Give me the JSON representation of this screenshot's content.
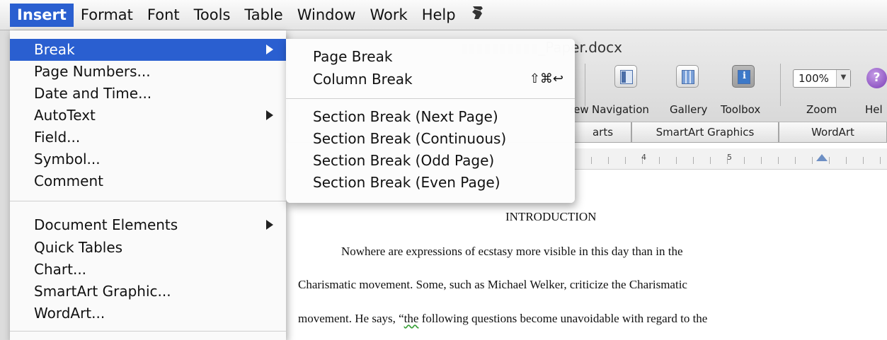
{
  "menubar": {
    "items": [
      "Insert",
      "Format",
      "Font",
      "Tools",
      "Table",
      "Window",
      "Work",
      "Help"
    ],
    "active": "Insert",
    "trailing_icon": "script-menu-icon"
  },
  "window": {
    "title_partial": "_Paper.docx"
  },
  "toolbar": {
    "view_partial": "iew",
    "navigation_label": "Navigation",
    "gallery_label": "Gallery",
    "toolbox_label": "Toolbox",
    "zoom_value": "100%",
    "zoom_label": "Zoom",
    "help_label": "Hel"
  },
  "ribbon": {
    "tabs": [
      "arts",
      "SmartArt Graphics",
      "WordArt"
    ]
  },
  "ruler": {
    "numbers": [
      "4",
      "5"
    ]
  },
  "insert_menu": {
    "items": [
      {
        "label": "Break",
        "has_submenu": true,
        "highlighted": true
      },
      {
        "label": "Page Numbers...",
        "has_submenu": false
      },
      {
        "label": "Date and Time...",
        "has_submenu": false
      },
      {
        "label": "AutoText",
        "has_submenu": true
      },
      {
        "label": "Field...",
        "has_submenu": false
      },
      {
        "label": "Symbol...",
        "has_submenu": false
      },
      {
        "label": "Comment",
        "has_submenu": false
      },
      {
        "label": "Document Elements",
        "has_submenu": true
      },
      {
        "label": "Quick Tables",
        "has_submenu": false
      },
      {
        "label": "Chart...",
        "has_submenu": false
      },
      {
        "label": "SmartArt Graphic...",
        "has_submenu": false
      },
      {
        "label": "WordArt...",
        "has_submenu": false
      }
    ]
  },
  "break_submenu": {
    "items": [
      {
        "label": "Page Break",
        "shortcut": ""
      },
      {
        "label": "Column Break",
        "shortcut": "⇧⌘↩"
      },
      {
        "label": "Section Break (Next Page)",
        "shortcut": ""
      },
      {
        "label": "Section Break (Continuous)",
        "shortcut": ""
      },
      {
        "label": "Section Break (Odd Page)",
        "shortcut": ""
      },
      {
        "label": "Section Break (Even Page)",
        "shortcut": ""
      }
    ]
  },
  "document": {
    "heading": "INTRODUCTION",
    "line1": "Nowhere are expressions of ecstasy more visible in this day than in the",
    "line2": "Charismatic movement. Some, such as Michael Welker, criticize the Charismatic",
    "line3_before": "movement. He says, “",
    "line3_squiggle": "the",
    "line3_after": " following questions become unavoidable with regard to the"
  },
  "colors": {
    "highlight": "#2a5fd0",
    "help_icon": "#7b3db6"
  }
}
